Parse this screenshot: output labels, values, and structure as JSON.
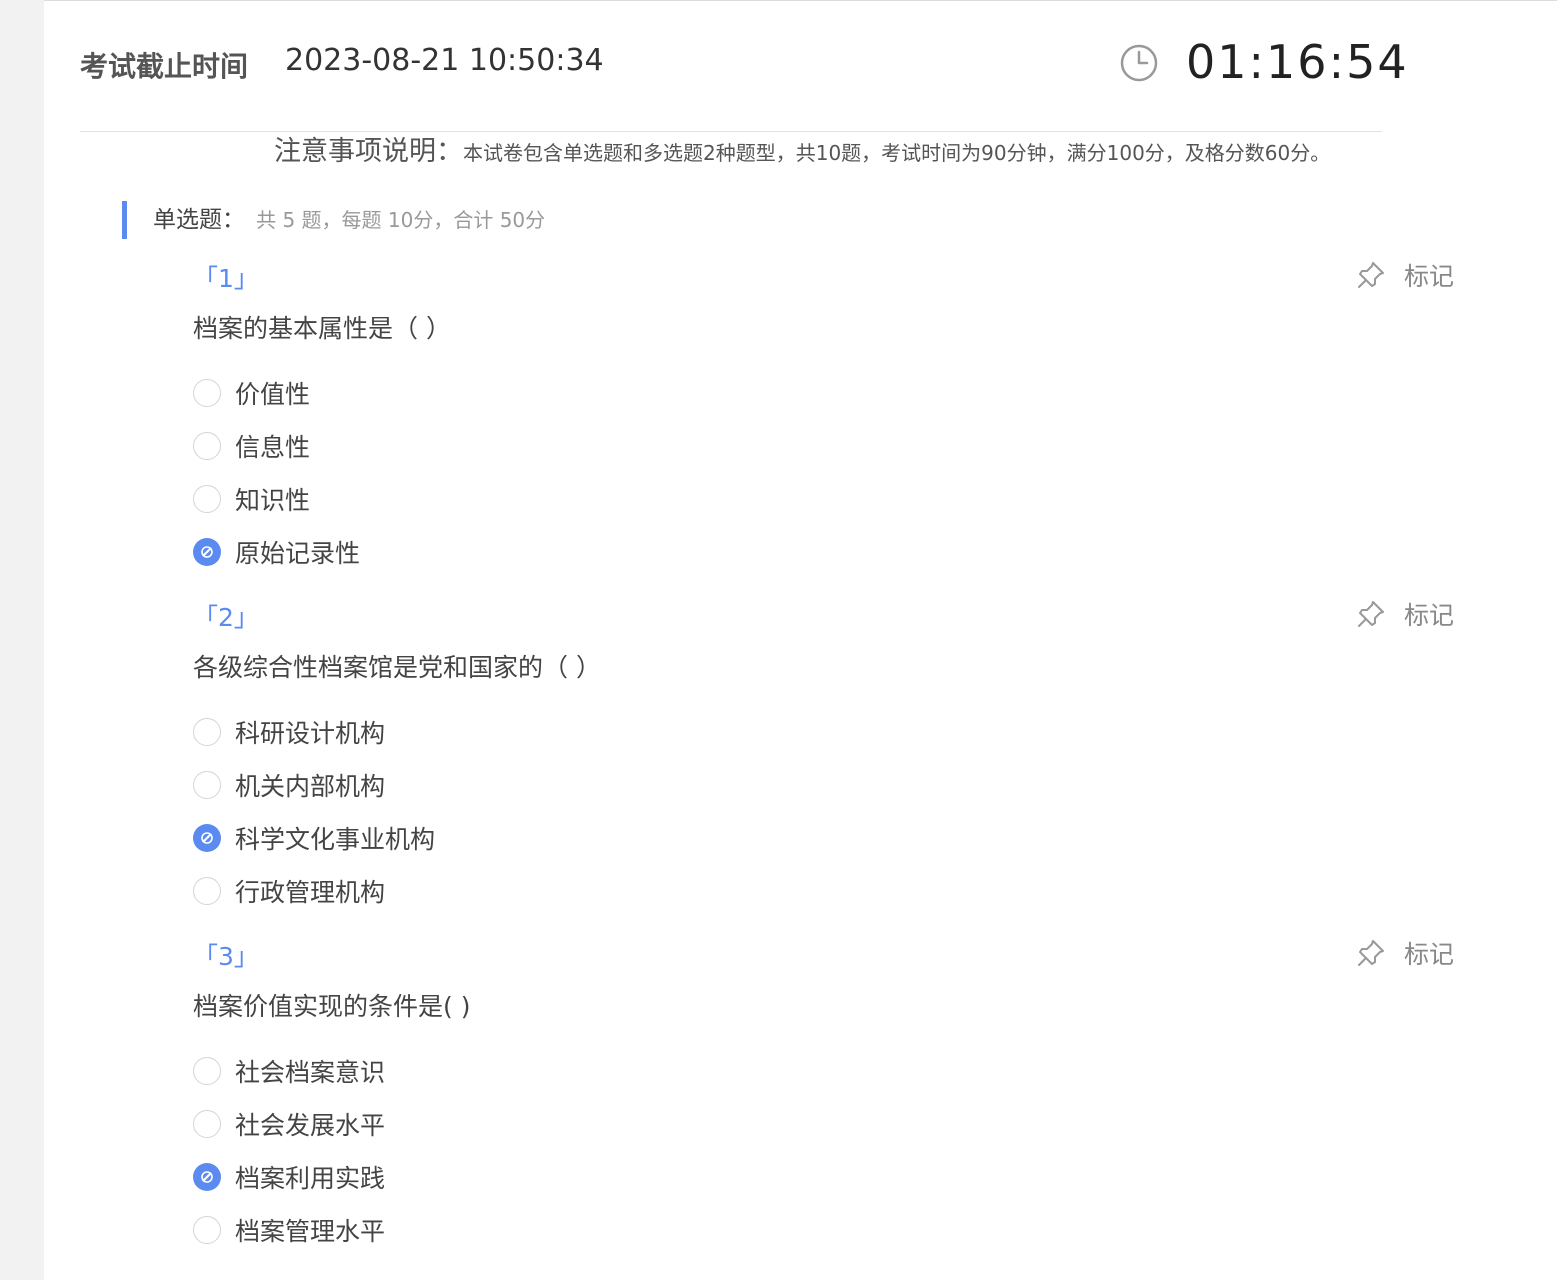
{
  "header": {
    "deadline_label": "考试截止时间",
    "deadline_value": "2023-08-21 10:50:34",
    "countdown": "01:16:54"
  },
  "notice": {
    "title": "注意事项说明：",
    "text": "本试卷包含单选题和多选题2种题型，共10题，考试时间为90分钟，满分100分，及格分数60分。"
  },
  "section": {
    "title": "单选题：",
    "meta": "共 5 题，每题 10分，合计 50分"
  },
  "questions": [
    {
      "number": "「1」",
      "mark_label": "标记",
      "text": "档案的基本属性是（ ）",
      "options": [
        {
          "label": "价值性",
          "selected": false
        },
        {
          "label": "信息性",
          "selected": false
        },
        {
          "label": "知识性",
          "selected": false
        },
        {
          "label": "原始记录性",
          "selected": true
        }
      ]
    },
    {
      "number": "「2」",
      "mark_label": "标记",
      "text": "各级综合性档案馆是党和国家的（ ）",
      "options": [
        {
          "label": "科研设计机构",
          "selected": false
        },
        {
          "label": "机关内部机构",
          "selected": false
        },
        {
          "label": "科学文化事业机构",
          "selected": true
        },
        {
          "label": "行政管理机构",
          "selected": false
        }
      ]
    },
    {
      "number": "「3」",
      "mark_label": "标记",
      "text": "档案价值实现的条件是( )",
      "options": [
        {
          "label": "社会档案意识",
          "selected": false
        },
        {
          "label": "社会发展水平",
          "selected": false
        },
        {
          "label": "档案利用实践",
          "selected": true
        },
        {
          "label": "档案管理水平",
          "selected": false
        }
      ]
    }
  ],
  "colors": {
    "accent": "#5b8af0",
    "panel": "#ffffff",
    "background": "#f2f2f2"
  }
}
